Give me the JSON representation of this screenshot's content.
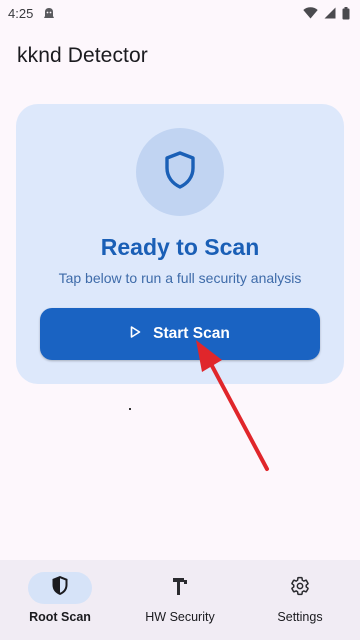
{
  "status_bar": {
    "time": "4:25"
  },
  "app_bar": {
    "title": "kknd Detector"
  },
  "scan_card": {
    "heading": "Ready to Scan",
    "subtitle": "Tap below to run a full security analysis",
    "button_label": "Start Scan",
    "icon": "shield-icon"
  },
  "bottom_nav": {
    "items": [
      {
        "label": "Root Scan",
        "icon": "shield-filled-icon",
        "active": true
      },
      {
        "label": "HW Security",
        "icon": "hammer-icon",
        "active": false
      },
      {
        "label": "Settings",
        "icon": "gear-icon",
        "active": false
      }
    ]
  },
  "colors": {
    "accent": "#1a63c2",
    "card_background": "#dde8fb",
    "heading": "#1a5fb6",
    "annotation_arrow": "#e0262b"
  }
}
